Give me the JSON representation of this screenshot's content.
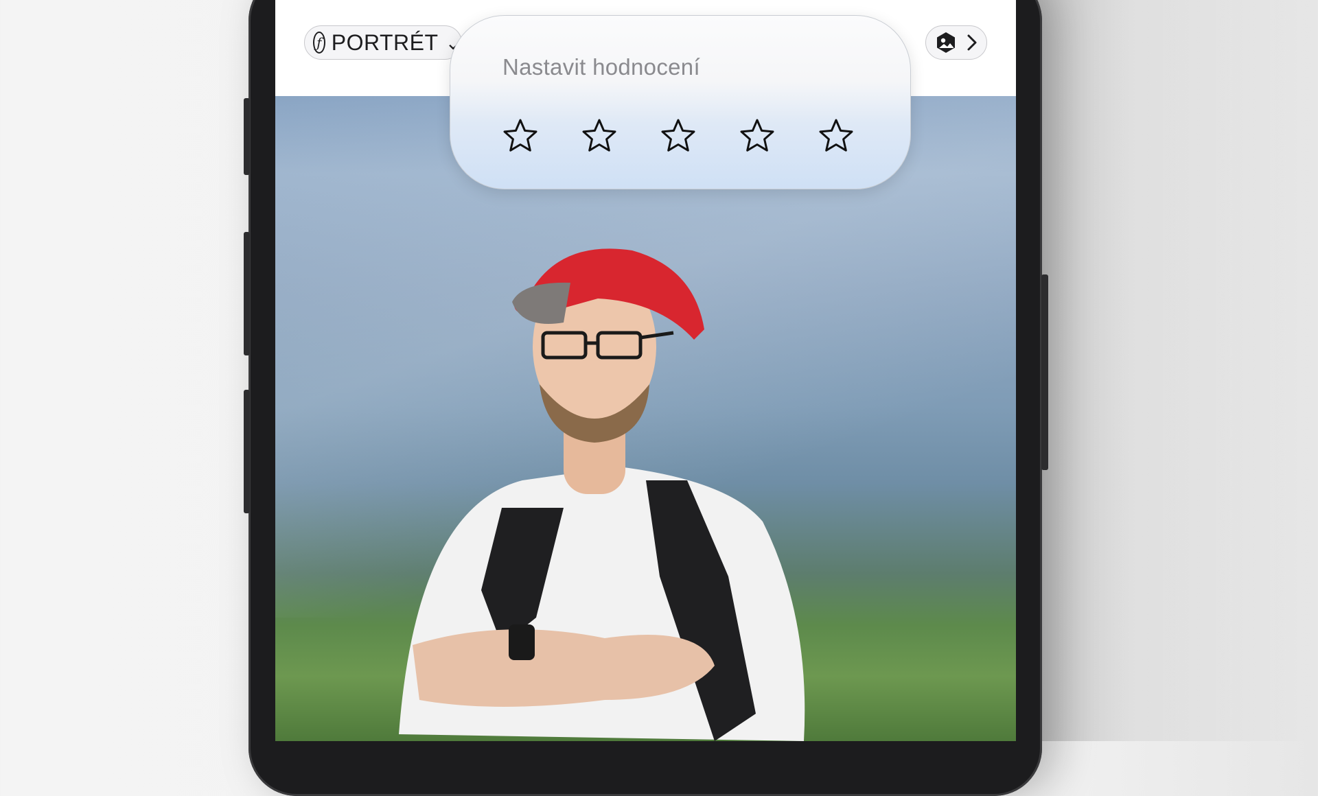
{
  "toolbar": {
    "style_label": "PORTRÉT",
    "style_icon": "f-stop-icon",
    "style_chevron": "chevron-down-icon",
    "edit_icon": "photo-style-icon",
    "edit_chevron": "chevron-right-icon"
  },
  "rating_popup": {
    "title": "Nastavit hodnocení",
    "stars_total": 5,
    "stars_selected": 0
  }
}
